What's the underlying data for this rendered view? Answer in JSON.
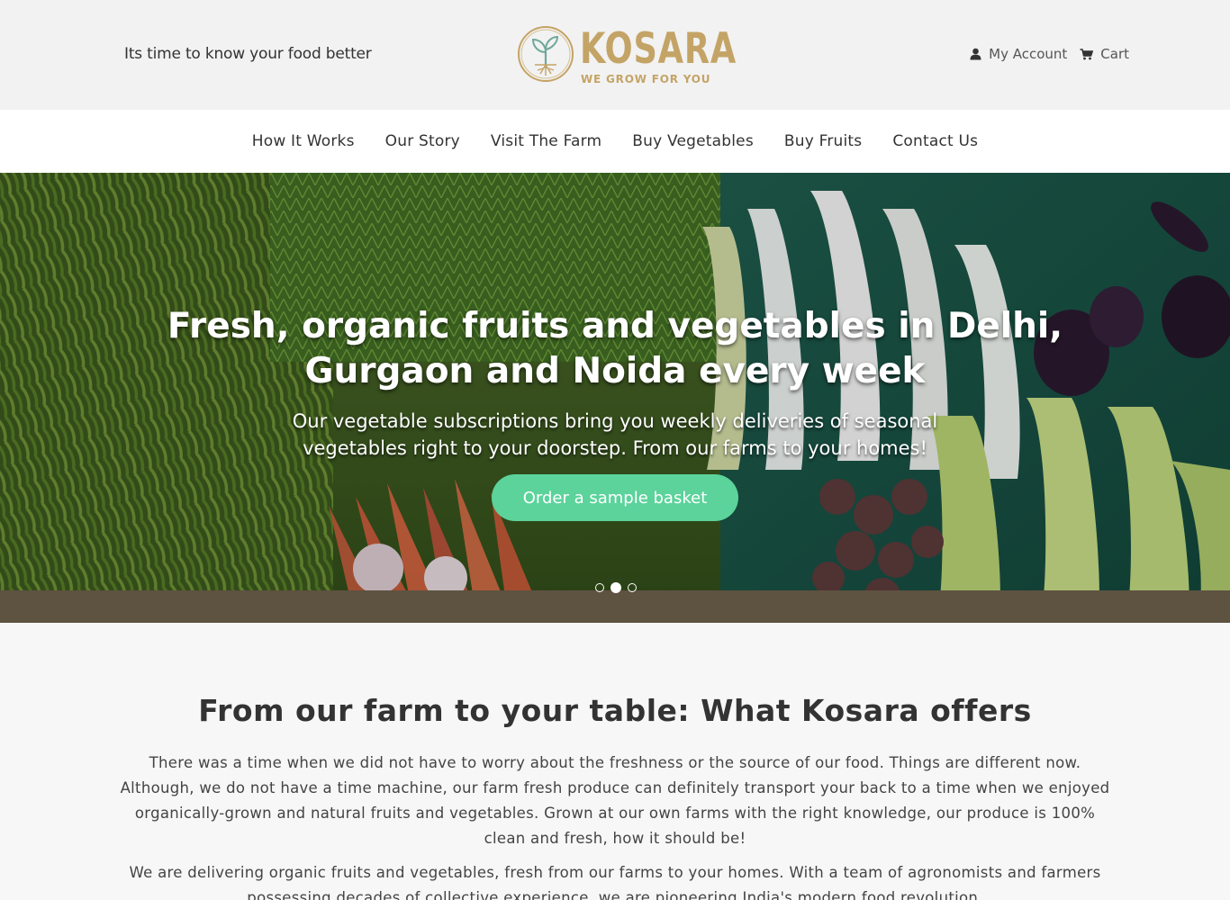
{
  "header": {
    "tagline": "Its time to know your food better",
    "logo_text": "KOSARA",
    "logo_subtext": "WE GROW FOR YOU",
    "account_label": "My Account",
    "cart_label": "Cart"
  },
  "nav": {
    "items": [
      {
        "label": "How It Works"
      },
      {
        "label": "Our Story"
      },
      {
        "label": "Visit The Farm"
      },
      {
        "label": "Buy Vegetables"
      },
      {
        "label": "Buy Fruits"
      },
      {
        "label": "Contact Us"
      }
    ]
  },
  "hero": {
    "title": "Fresh, organic fruits and vegetables in Delhi, Gurgaon and Noida every week",
    "subtitle": "Our vegetable subscriptions bring you weekly deliveries of seasonal vegetables right to your doorstep. From our farms to your homes!",
    "cta_label": "Order a sample basket",
    "slides_total": 3,
    "active_slide": 2
  },
  "intro": {
    "title": "From our farm to your table: What Kosara offers",
    "paragraph1": "There was a time when we did not have to worry about the freshness or the source of our food. Things are different now. Although, we do not have a time machine, our farm fresh produce can definitely transport your back to a time when we enjoyed organically-grown and natural fruits and vegetables. Grown at our own farms with the right knowledge, our produce is 100% clean and fresh, how it should be!",
    "paragraph2": "We are delivering organic fruits and vegetables, fresh from our farms to your homes. With a team of agronomists and farmers possessing decades of collective experience, we are pioneering India's modern food revolution."
  },
  "colors": {
    "brand_gold": "#c4a466",
    "cta_green": "#5bd39b",
    "topbar_bg": "#f2f2f2"
  },
  "icons": [
    "leaf-logo-icon",
    "user-icon",
    "cart-icon"
  ]
}
